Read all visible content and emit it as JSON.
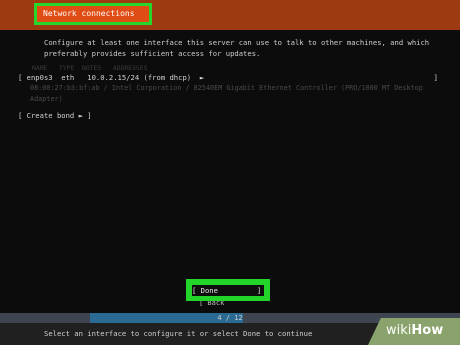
{
  "header": {
    "title": "Network connections"
  },
  "intro": "Configure at least one interface this server can use to talk to other machines, and which preferably provides sufficient access for updates.",
  "table": {
    "columns": [
      "NAME",
      "TYPE",
      "NOTES",
      "ADDRESSES"
    ],
    "row": {
      "lbracket": "[",
      "name": "enp0s3",
      "type": "eth",
      "address": "10.0.2.15/24 (from dhcp)",
      "arrow": "►",
      "rbracket": "]"
    },
    "hardware": "08:00:27:b3:bf:ab / Intel Corporation / 82540EM Gigabit Ethernet Controller (PRO/1000 MT Desktop Adapter)"
  },
  "create_bond": "[ Create bond ► ]",
  "done_label": "[ Done         ]",
  "back_label": "[ Back         ]",
  "progress": {
    "text": "4 / 12",
    "fraction": 0.333
  },
  "footer": "Select an interface to configure it or select Done to continue",
  "watermark": {
    "part1": "wiki",
    "part2": "How"
  }
}
